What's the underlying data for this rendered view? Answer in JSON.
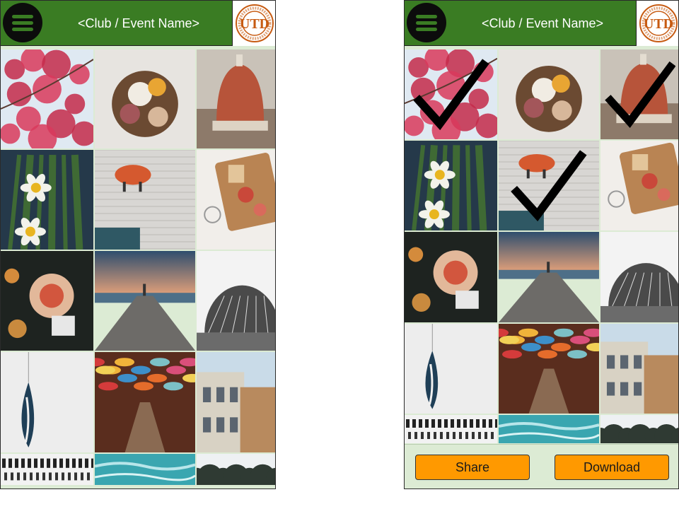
{
  "header": {
    "title": "<Club / Event Name>",
    "logo": {
      "text": "UTD",
      "ring_text": "THE UNIVERSITY OF TEXAS AT DALLAS",
      "est_text": "EST. 1969"
    }
  },
  "actions": {
    "share_label": "Share",
    "download_label": "Download"
  },
  "colors": {
    "header_green": "#3a7c23",
    "button_orange": "#ff9900",
    "panel_background": "#dcebd4",
    "logo_orange": "#c75b12"
  },
  "gallery": {
    "left_screen": [
      {
        "photo": "pink-blossoms",
        "selected": false
      },
      {
        "photo": "dried-flower-bouquet",
        "selected": false
      },
      {
        "photo": "florence-cathedral-dome",
        "selected": false
      },
      {
        "photo": "daffodils",
        "selected": false
      },
      {
        "photo": "pig-on-brick-wall",
        "selected": false
      },
      {
        "photo": "toast-breakfast-tray",
        "selected": false
      },
      {
        "photo": "food-spread-table",
        "selected": false
      },
      {
        "photo": "stone-pier-sunset",
        "selected": false
      },
      {
        "photo": "geodesic-sphere",
        "selected": false
      },
      {
        "photo": "hanging-feather",
        "selected": false
      },
      {
        "photo": "umbrella-alley",
        "selected": false
      },
      {
        "photo": "street-buildings",
        "selected": false
      },
      {
        "photo": "piano-keys",
        "selected": false
      },
      {
        "photo": "ocean-water",
        "selected": false
      },
      {
        "photo": "tree-line",
        "selected": false
      }
    ],
    "right_screen": [
      {
        "photo": "pink-blossoms",
        "selected": true
      },
      {
        "photo": "dried-flower-bouquet",
        "selected": false
      },
      {
        "photo": "florence-cathedral-dome",
        "selected": true
      },
      {
        "photo": "daffodils",
        "selected": false
      },
      {
        "photo": "pig-on-brick-wall",
        "selected": true
      },
      {
        "photo": "toast-breakfast-tray",
        "selected": false
      },
      {
        "photo": "food-spread-table",
        "selected": false
      },
      {
        "photo": "stone-pier-sunset",
        "selected": false
      },
      {
        "photo": "geodesic-sphere",
        "selected": false
      },
      {
        "photo": "hanging-feather",
        "selected": false
      },
      {
        "photo": "umbrella-alley",
        "selected": false
      },
      {
        "photo": "street-buildings",
        "selected": false
      },
      {
        "photo": "piano-keys",
        "selected": false
      },
      {
        "photo": "ocean-water",
        "selected": false
      },
      {
        "photo": "tree-line",
        "selected": false
      }
    ]
  }
}
